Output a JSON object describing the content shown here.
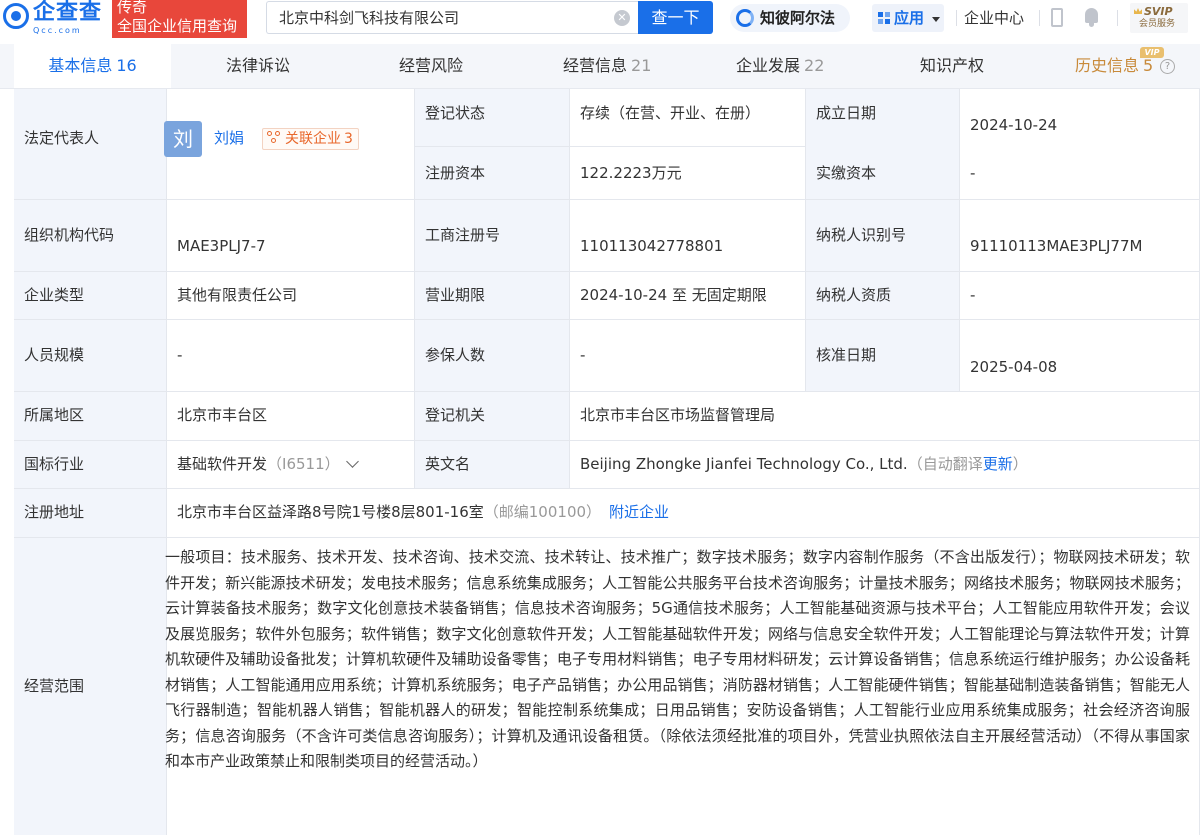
{
  "header": {
    "logo_text": "企查查",
    "logo_sub": "Qcc.com",
    "tag_line1": "传奇",
    "tag_line2": "全国企业信用查询",
    "search_value": "北京中科剑飞科技有限公司",
    "search_button": "查一下",
    "zbaf_label": "知彼阿尔法",
    "app_label": "应用",
    "enterprise_center": "企业中心",
    "svip_line1": "SVIP",
    "svip_line2": "会员服务"
  },
  "tabs": [
    {
      "label": "基本信息",
      "count": "16"
    },
    {
      "label": "法律诉讼",
      "count": ""
    },
    {
      "label": "经营风险",
      "count": ""
    },
    {
      "label": "经营信息",
      "count": "21"
    },
    {
      "label": "企业发展",
      "count": "22"
    },
    {
      "label": "知识产权",
      "count": ""
    },
    {
      "label": "历史信息",
      "count": "5"
    }
  ],
  "vip_badge": "VIP",
  "info": {
    "legal_rep_label": "法定代表人",
    "legal_rep_avatar": "刘",
    "legal_rep_name": "刘娟",
    "related_label": "关联企业",
    "related_count": "3",
    "reg_status_label": "登记状态",
    "reg_status": "存续（在营、开业、在册）",
    "est_date_label": "成立日期",
    "est_date": "2024-10-24",
    "reg_capital_label": "注册资本",
    "reg_capital": "122.2223万元",
    "paid_capital_label": "实缴资本",
    "paid_capital": "-",
    "org_code_label": "组织机构代码",
    "org_code": "MAE3PLJ7-7",
    "biz_reg_no_label": "工商注册号",
    "biz_reg_no": "110113042778801",
    "tax_id_label": "纳税人识别号",
    "tax_id": "91110113MAE3PLJ77M",
    "company_type_label": "企业类型",
    "company_type": "其他有限责任公司",
    "biz_term_label": "营业期限",
    "biz_term": "2024-10-24 至 无固定期限",
    "taxpayer_qual_label": "纳税人资质",
    "taxpayer_qual": "-",
    "staff_label": "人员规模",
    "staff": "-",
    "insured_label": "参保人数",
    "insured": "-",
    "approval_date_label": "核准日期",
    "approval_date": "2025-04-08",
    "region_label": "所属地区",
    "region": "北京市丰台区",
    "authority_label": "登记机关",
    "authority": "北京市丰台区市场监督管理局",
    "industry_label": "国标行业",
    "industry": "基础软件开发",
    "industry_code": "（I6511）",
    "english_name_label": "英文名",
    "english_name": "Beijing Zhongke Jianfei Technology Co., Ltd.",
    "auto_translate": "（自动翻译",
    "update_link": "更新",
    "auto_translate_end": "）",
    "address_label": "注册地址",
    "address": "北京市丰台区益泽路8号院1号楼8层801-16室",
    "postcode": "（邮编100100）",
    "nearby_link": "附近企业",
    "scope_label": "经营范围",
    "scope": "一般项目：技术服务、技术开发、技术咨询、技术交流、技术转让、技术推广；数字技术服务；数字内容制作服务（不含出版发行）；物联网技术研发；软件开发；新兴能源技术研发；发电技术服务；信息系统集成服务；人工智能公共服务平台技术咨询服务；计量技术服务；网络技术服务；物联网技术服务；云计算装备技术服务；数字文化创意技术装备销售；信息技术咨询服务；5G通信技术服务；人工智能基础资源与技术平台；人工智能应用软件开发；会议及展览服务；软件外包服务；软件销售；数字文化创意软件开发；人工智能基础软件开发；网络与信息安全软件开发；人工智能理论与算法软件开发；计算机软硬件及辅助设备批发；计算机软硬件及辅助设备零售；电子专用材料销售；电子专用材料研发；云计算设备销售；信息系统运行维护服务；办公设备耗材销售；人工智能通用应用系统；计算机系统服务；电子产品销售；办公用品销售；消防器材销售；人工智能硬件销售；智能基础制造装备销售；智能无人飞行器制造；智能机器人销售；智能机器人的研发；智能控制系统集成；日用品销售；安防设备销售；人工智能行业应用系统集成服务；社会经济咨询服务；信息咨询服务（不含许可类信息咨询服务）；计算机及通讯设备租赁。（除依法须经批准的项目外，凭营业执照依法自主开展经营活动）（不得从事国家和本市产业政策禁止和限制类项目的经营活动。）"
  }
}
